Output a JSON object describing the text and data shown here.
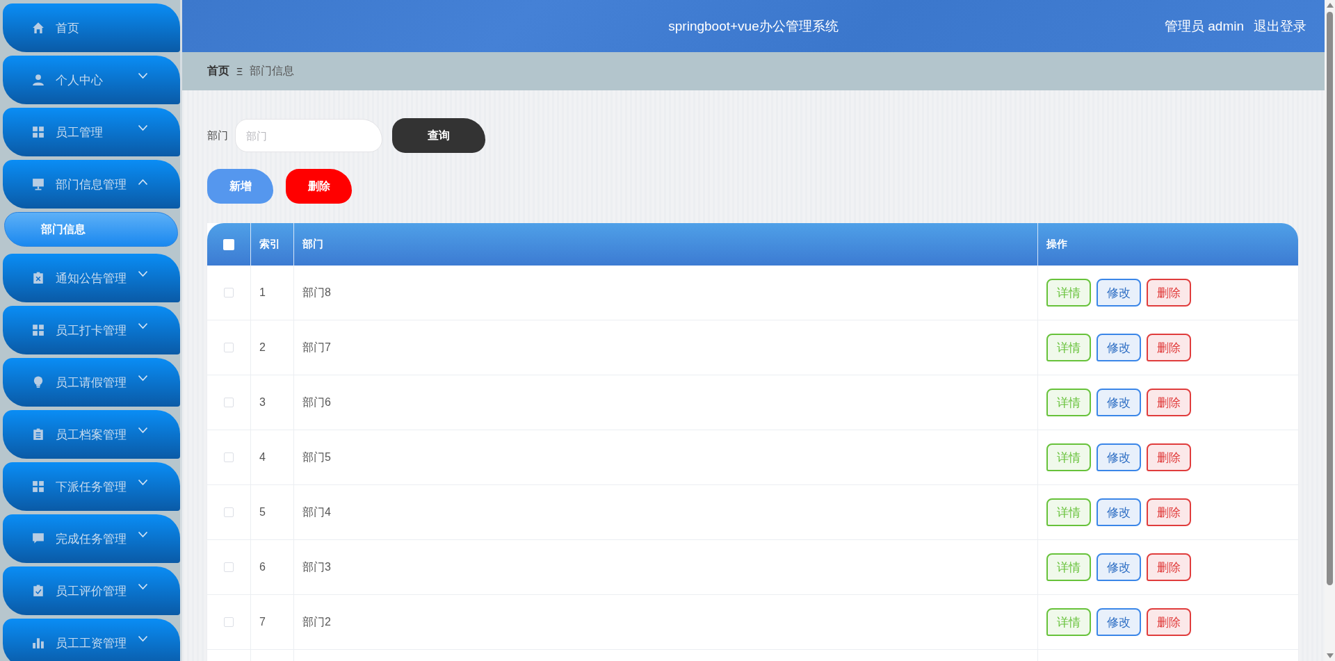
{
  "sidebar": {
    "items": [
      {
        "label": "首页",
        "kind": "link"
      },
      {
        "label": "个人中心",
        "kind": "submenu",
        "expanded": false
      },
      {
        "label": "员工管理",
        "kind": "submenu",
        "expanded": false
      },
      {
        "label": "部门信息管理",
        "kind": "submenu",
        "expanded": true,
        "children": [
          {
            "label": "部门信息",
            "selected": true
          }
        ]
      },
      {
        "label": "通知公告管理",
        "kind": "submenu",
        "expanded": false
      },
      {
        "label": "员工打卡管理",
        "kind": "submenu",
        "expanded": false
      },
      {
        "label": "员工请假管理",
        "kind": "submenu",
        "expanded": false
      },
      {
        "label": "员工档案管理",
        "kind": "submenu",
        "expanded": false
      },
      {
        "label": "下派任务管理",
        "kind": "submenu",
        "expanded": false
      },
      {
        "label": "完成任务管理",
        "kind": "submenu",
        "expanded": false
      },
      {
        "label": "员工评价管理",
        "kind": "submenu",
        "expanded": false
      },
      {
        "label": "员工工资管理",
        "kind": "submenu",
        "expanded": false
      }
    ]
  },
  "header": {
    "title": "springboot+vue办公管理系统",
    "user": "管理员 admin",
    "logout": "退出登录"
  },
  "breadcrumb": {
    "items": [
      "首页",
      "部门信息"
    ],
    "separator": "Ξ"
  },
  "search": {
    "label": "部门",
    "placeholder": "部门",
    "button": "查询"
  },
  "actions": [
    {
      "label": "新增",
      "kind": "add"
    },
    {
      "label": "删除",
      "kind": "delete"
    }
  ],
  "table": {
    "select_all_checked": false,
    "columns": [
      "索引",
      "部门",
      "操作"
    ],
    "rows": [
      {
        "index": "1",
        "department": "部门8",
        "checked": false,
        "buttons": [
          "详情",
          "修改",
          "删除"
        ]
      },
      {
        "index": "2",
        "department": "部门7",
        "checked": false,
        "buttons": [
          "详情",
          "修改",
          "删除"
        ]
      },
      {
        "index": "3",
        "department": "部门6",
        "checked": false,
        "buttons": [
          "详情",
          "修改",
          "删除"
        ]
      },
      {
        "index": "4",
        "department": "部门5",
        "checked": false,
        "buttons": [
          "详情",
          "修改",
          "删除"
        ]
      },
      {
        "index": "5",
        "department": "部门4",
        "checked": false,
        "buttons": [
          "详情",
          "修改",
          "删除"
        ]
      },
      {
        "index": "6",
        "department": "部门3",
        "checked": false,
        "buttons": [
          "详情",
          "修改",
          "删除"
        ]
      },
      {
        "index": "7",
        "department": "部门2",
        "checked": false,
        "buttons": [
          "详情",
          "修改",
          "删除"
        ]
      }
    ]
  }
}
